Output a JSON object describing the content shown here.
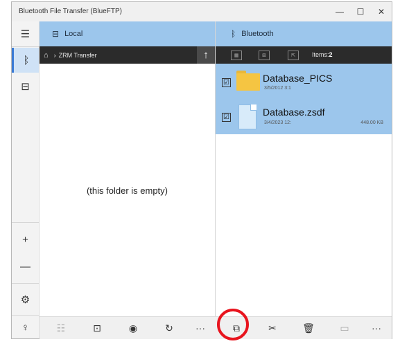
{
  "window": {
    "title": "Bluetooth File Transfer (BlueFTP)",
    "controls": {
      "minimize": "—",
      "maximize": "☐",
      "close": "✕"
    }
  },
  "rail": {
    "menu_icon": "☰",
    "bluetooth_icon": "ᛒ",
    "devices_icon": "⊟",
    "add_icon": "+",
    "remove_icon": "—",
    "settings_icon": "⚙",
    "tips_icon": "♀"
  },
  "local": {
    "header_label": "Local",
    "breadcrumb_home": "⌂",
    "breadcrumb_sep": "›",
    "breadcrumb_path": "ZRM Transfer",
    "up_icon": "↑",
    "empty_text": "(this folder is empty)"
  },
  "bluetooth": {
    "header_label": "Bluetooth",
    "header_icon": "ᛒ",
    "items_label": "Items:",
    "items_count": "2",
    "files": [
      {
        "name": "Database_PICS",
        "date": "3/5/2012 3:1",
        "size": "",
        "type": "folder",
        "checked": "☑"
      },
      {
        "name": "Database.zsdf",
        "date": "3/4/2023 12:",
        "size": "448.00 KB",
        "type": "file",
        "checked": "☑"
      }
    ]
  },
  "toolbar": {
    "select_icon": "☷",
    "new_icon": "⊡",
    "view_icon": "◉",
    "refresh_icon": "↻",
    "more_left": "···",
    "copy_icon": "⧉",
    "cut_icon": "✂",
    "delete_icon": "🗑",
    "rename_icon": "▭",
    "more_right": "···"
  },
  "colors": {
    "accent": "#9cc6ec",
    "dark_bar": "#2b2b2b",
    "highlight_ring": "#e8141e"
  }
}
